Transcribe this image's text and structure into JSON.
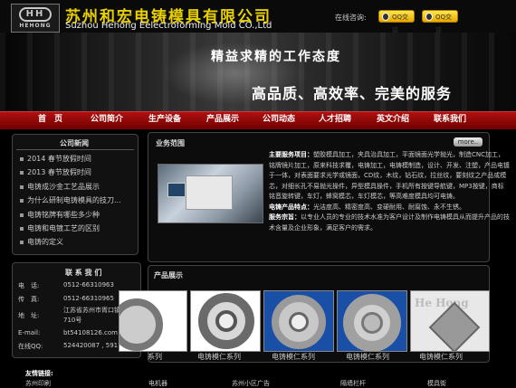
{
  "header": {
    "logo_text": "HH",
    "logo_sub": "HEHONG",
    "company_cn": "苏州和宏电铸模具有限公司",
    "company_en": "Suzhou Hehong Eelectroforming Mold CO.,Ltd",
    "online_label": "在线咨询:",
    "qq_buttons": [
      "QQ交谈",
      "QQ交谈"
    ]
  },
  "banner": {
    "slogan1": "精益求精的工作态度",
    "slogan2": "高品质、高效率、完美的服务"
  },
  "nav": {
    "items": [
      "首　页",
      "公司简介",
      "生产设备",
      "产品展示",
      "公司动态",
      "人才招聘",
      "英文介绍",
      "联系我们"
    ]
  },
  "news": {
    "title": "公司新闻",
    "items": [
      "2014  春节放假时间",
      "2013  春节放假时间",
      "电铸成沙金工艺品展示",
      "为什么研制电铸模具的技刀...",
      "电铸铭牌有哪些多少种",
      "电铸和电镀工艺的区别",
      "电铸的定义"
    ]
  },
  "contact": {
    "title": "联 系 我 们",
    "phone_label": "电　话:",
    "phone": "0512-66310963",
    "fax_label": "传　真:",
    "fax": "0512-66310965",
    "address_label": "地　址:",
    "address_lines": [
      "江苏省苏州市胥口镇东欣路",
      "710号"
    ],
    "email_label": "E-mail:",
    "email": "bt54108126.com",
    "qq_label": "在线QQ:",
    "qq": "524420087 , 591774722"
  },
  "business": {
    "title": "业务范围",
    "more": "more..",
    "main_label": "主要服务项目：",
    "main_text": "塑胶模具加工，夹具治具加工，平面镜面光学抛光，制造CNC加工，铭牌镜片加工，原来科技求覆，电铸加工，电铸模制造，设计、开发、注塑，产品电镀于一体，对表面要求光学或镜面，CD纹，木纹，钻石纹，拉丝纹，要刻纹之产品或模芯，对细长孔不易抛光操件，异型模具操件，手机所有按键导航键，MP3按键，商标铭音旋转键，车灯，蜂窝模芯，车灯模芯，等高难度模具均可电铸。",
    "feature_label": "电铸产品特点：",
    "feature_text": "光洁度高、精密度高、变硬耐用、耐腐蚀、永不生锈。",
    "service_label": "服务宗旨：",
    "service_text": "以专业人员的专业的技术水准为客户设计及制作电铸模具从而提升产品的技术含量及企业形象，满足客户的需求。"
  },
  "products": {
    "title": "产品展示",
    "captions": [
      "系列",
      "电铸模仁系列",
      "电铸模仁系列",
      "电铸模仁系列",
      "电铸模仁系列"
    ]
  },
  "footer": {
    "links_label": "友情链接:",
    "links": [
      "苏州印刷",
      "电机器",
      "苏州小区广告",
      "隔墙栏杆",
      "模具街"
    ]
  }
}
